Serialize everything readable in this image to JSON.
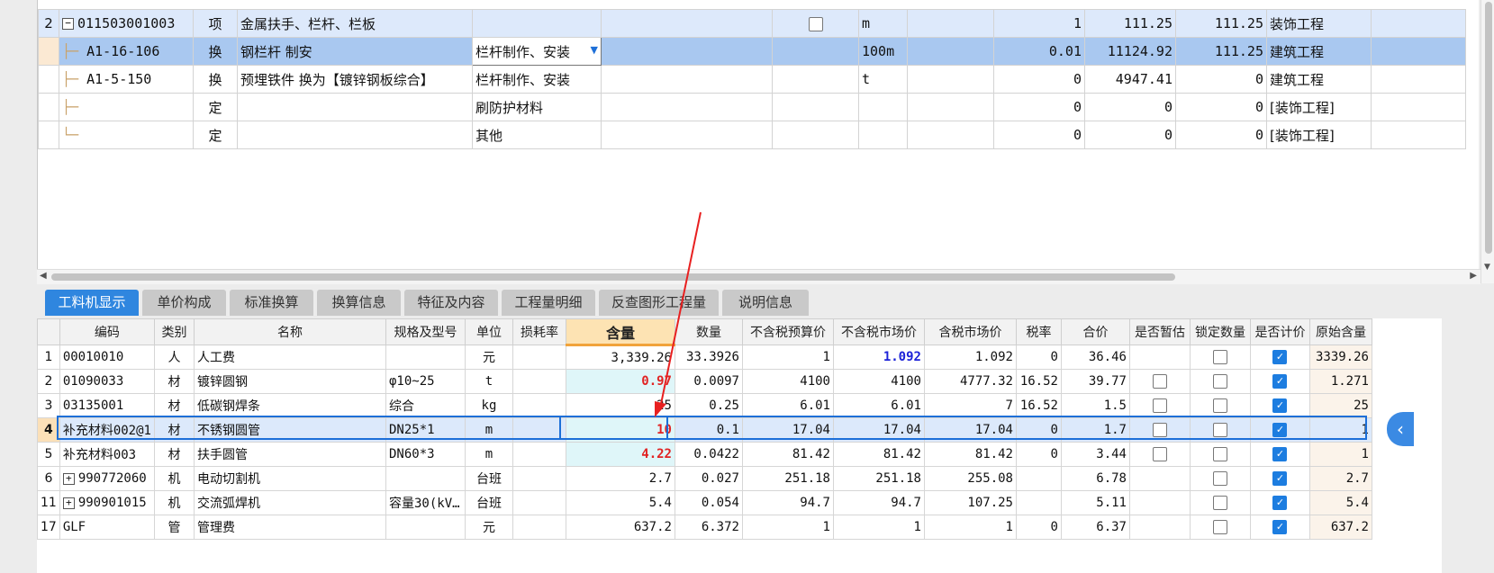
{
  "upper_rows": [
    {
      "no": "2",
      "expander": "−",
      "code": "011503001003",
      "type": "项",
      "name": "金属扶手、栏杆、栏板",
      "spec": "",
      "checkbox": true,
      "unit": "m",
      "qty": "1",
      "price": "111.25",
      "total": "111.25",
      "category": "装饰工程",
      "style": "light"
    },
    {
      "no": "",
      "expander": "",
      "code": "A1-16-106",
      "type": "换",
      "name": "钢栏杆 制安",
      "spec": "栏杆制作、安装",
      "dropdown": "▼",
      "unit": "100m",
      "qty": "0.01",
      "price": "11124.92",
      "total": "111.25",
      "category": "建筑工程",
      "style": "sel"
    },
    {
      "no": "",
      "expander": "",
      "code": "A1-5-150",
      "type": "换",
      "name": "预埋铁件  换为【镀锌钢板综合】",
      "spec": "栏杆制作、安装",
      "unit": "t",
      "qty": "0",
      "price": "4947.41",
      "total": "0",
      "category": "建筑工程",
      "style": ""
    },
    {
      "no": "",
      "expander": "",
      "code": "",
      "type": "定",
      "name": "",
      "spec": "刷防护材料",
      "unit": "",
      "qty": "0",
      "price": "0",
      "total": "0",
      "category": "[装饰工程]",
      "style": ""
    },
    {
      "no": "",
      "expander": "",
      "code": "",
      "type": "定",
      "name": "",
      "spec": "其他",
      "unit": "",
      "qty": "0",
      "price": "0",
      "total": "0",
      "category": "[装饰工程]",
      "style": ""
    }
  ],
  "tabs": [
    "工料机显示",
    "单价构成",
    "标准换算",
    "换算信息",
    "特征及内容",
    "工程量明细",
    "反查图形工程量",
    "说明信息"
  ],
  "columns": [
    "",
    "编码",
    "类别",
    "名称",
    "规格及型号",
    "单位",
    "损耗率",
    "含量",
    "数量",
    "不含税预算价",
    "不含税市场价",
    "含税市场价",
    "税率",
    "合价",
    "是否暂估",
    "锁定数量",
    "是否计价",
    "原始含量"
  ],
  "rows": [
    {
      "rn": "1",
      "code": "00010010",
      "cat": "人",
      "name": "人工费",
      "spec": "",
      "unit": "元",
      "loss": "",
      "content": "3,339.26",
      "qty": "33.3926",
      "budget": "1",
      "market": "1.092",
      "tax_market": "1.092",
      "rate": "0",
      "total": "36.46",
      "est": null,
      "lock": false,
      "priced": true,
      "orig": "3339.26",
      "content_style": "",
      "market_style": "blue"
    },
    {
      "rn": "2",
      "code": "01090033",
      "cat": "材",
      "name": "镀锌圆钢",
      "spec": "φ10~25",
      "unit": "t",
      "loss": "",
      "content": "0.97",
      "qty": "0.0097",
      "budget": "4100",
      "market": "4100",
      "tax_market": "4777.32",
      "rate": "16.52",
      "total": "39.77",
      "est": false,
      "lock": false,
      "priced": true,
      "orig": "1.271",
      "content_style": "red",
      "market_style": ""
    },
    {
      "rn": "3",
      "code": "03135001",
      "cat": "材",
      "name": "低碳钢焊条",
      "spec": "综合",
      "unit": "kg",
      "loss": "",
      "content": "25",
      "qty": "0.25",
      "budget": "6.01",
      "market": "6.01",
      "tax_market": "7",
      "rate": "16.52",
      "total": "1.5",
      "est": false,
      "lock": false,
      "priced": true,
      "orig": "25",
      "content_style": "",
      "market_style": ""
    },
    {
      "rn": "4",
      "code": "补充材料002@1",
      "cat": "材",
      "name": "不锈钢圆管",
      "spec": "DN25*1",
      "unit": "m",
      "loss": "",
      "content": "10",
      "qty": "0.1",
      "budget": "17.04",
      "market": "17.04",
      "tax_market": "17.04",
      "rate": "0",
      "total": "1.7",
      "est": false,
      "lock": false,
      "priced": true,
      "orig": "1",
      "content_style": "red",
      "market_style": "",
      "selected": true
    },
    {
      "rn": "5",
      "code": "补充材料003",
      "cat": "材",
      "name": "扶手圆管",
      "spec": "DN60*3",
      "unit": "m",
      "loss": "",
      "content": "4.22",
      "qty": "0.0422",
      "budget": "81.42",
      "market": "81.42",
      "tax_market": "81.42",
      "rate": "0",
      "total": "3.44",
      "est": false,
      "lock": false,
      "priced": true,
      "orig": "1",
      "content_style": "red",
      "market_style": ""
    },
    {
      "rn": "6",
      "code": "990772060",
      "expander": "+",
      "cat": "机",
      "name": "电动切割机",
      "spec": "",
      "unit": "台班",
      "loss": "",
      "content": "2.7",
      "qty": "0.027",
      "budget": "251.18",
      "market": "251.18",
      "tax_market": "255.08",
      "rate": "",
      "total": "6.78",
      "est": null,
      "lock": false,
      "priced": true,
      "orig": "2.7",
      "content_style": "",
      "market_style": ""
    },
    {
      "rn": "11",
      "code": "990901015",
      "expander": "+",
      "cat": "机",
      "name": "交流弧焊机",
      "spec": "容量30(kV…",
      "unit": "台班",
      "loss": "",
      "content": "5.4",
      "qty": "0.054",
      "budget": "94.7",
      "market": "94.7",
      "tax_market": "107.25",
      "rate": "",
      "total": "5.11",
      "est": null,
      "lock": false,
      "priced": true,
      "orig": "5.4",
      "content_style": "",
      "market_style": ""
    },
    {
      "rn": "17",
      "code": "GLF",
      "cat": "管",
      "name": "管理费",
      "spec": "",
      "unit": "元",
      "loss": "",
      "content": "637.2",
      "qty": "6.372",
      "budget": "1",
      "market": "1",
      "tax_market": "1",
      "rate": "0",
      "total": "6.37",
      "est": null,
      "lock": false,
      "priced": true,
      "orig": "637.2",
      "content_style": "",
      "market_style": ""
    }
  ],
  "colors": {
    "accent": "#2f86df",
    "red_value": "#e12323",
    "blue_value": "#1c22d8",
    "selection": "#1d6fd8"
  },
  "icons": {
    "side_handle": "chevron-left-icon",
    "expander": "tree-expander-icon",
    "scroll": "scroll-arrow-icon"
  }
}
